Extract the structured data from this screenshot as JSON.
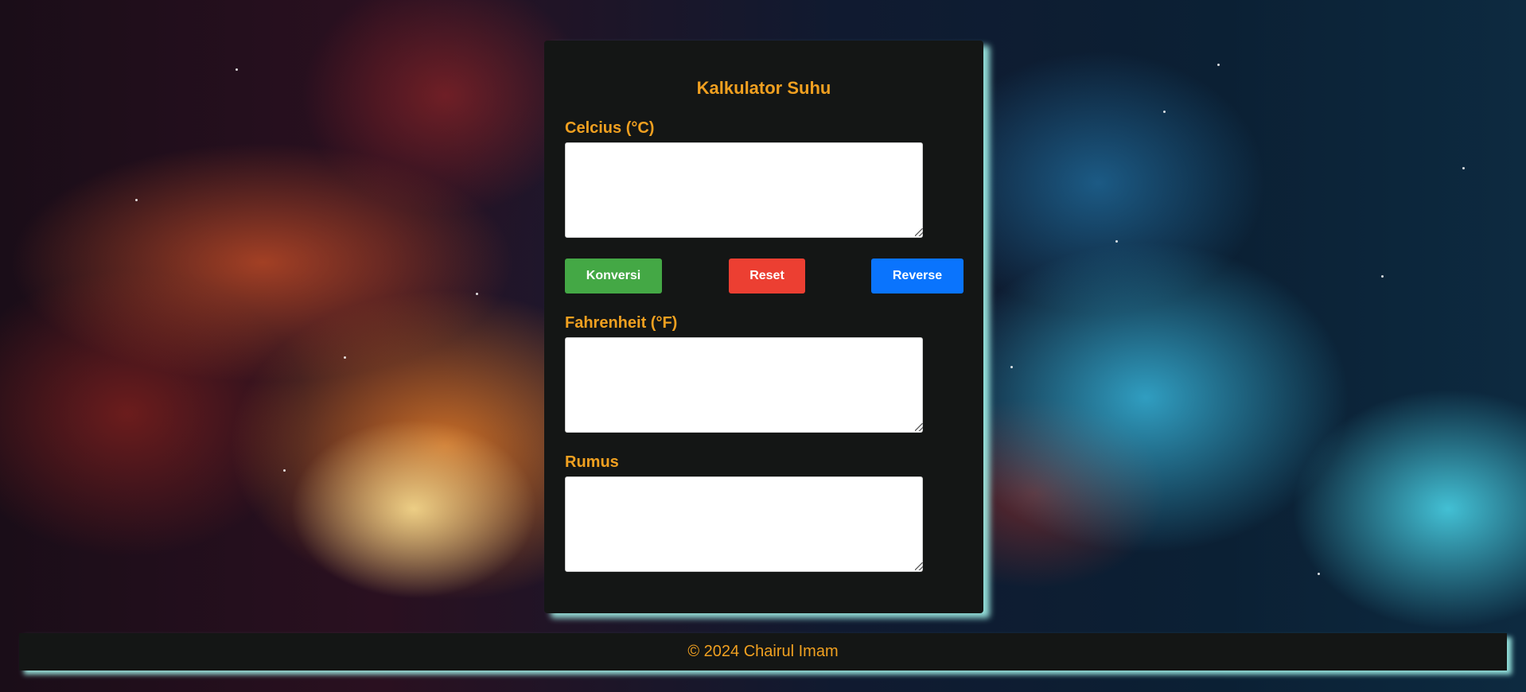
{
  "app": {
    "title": "Kalkulator Suhu"
  },
  "fields": {
    "celcius": {
      "label": "Celcius (°C)",
      "value": ""
    },
    "fahrenheit": {
      "label": "Fahrenheit (°F)",
      "value": ""
    },
    "rumus": {
      "label": "Rumus",
      "value": ""
    }
  },
  "buttons": {
    "konversi": "Konversi",
    "reset": "Reset",
    "reverse": "Reverse"
  },
  "footer": {
    "text": "© 2024 Chairul Imam"
  },
  "colors": {
    "accent": "#f0a020",
    "panel": "#141615",
    "konversi": "#44a845",
    "reset": "#ec3f32",
    "reverse": "#0a74fd",
    "glow": "#aafff5"
  }
}
